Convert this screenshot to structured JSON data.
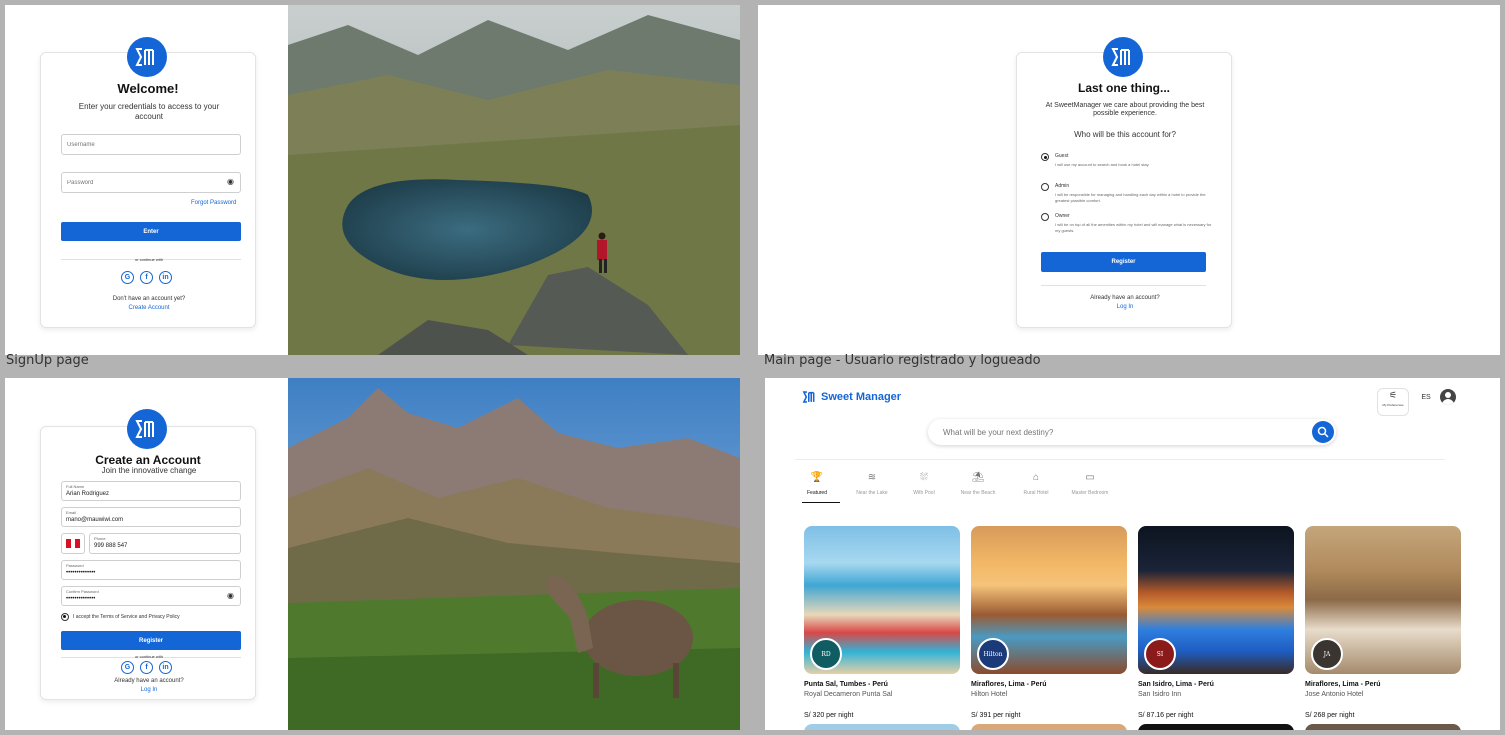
{
  "frames": {
    "signup_label": "SignUp page",
    "main_label": "Main page - Usuario registrado y logueado"
  },
  "login": {
    "title": "Welcome!",
    "subtitle": "Enter your credentials to access to your account",
    "username_placeholder": "Username",
    "password_placeholder": "Password",
    "forgot": "Forgot Password",
    "enter_button": "Enter",
    "continue_with": "or continue with",
    "no_account": "Don't have an account yet?",
    "create_account": "Create Account"
  },
  "role": {
    "title": "Last one thing...",
    "subtitle": "At SweetManager we care about providing the best possible experience.",
    "question": "Who will be this account for?",
    "options": [
      {
        "title": "Guest",
        "desc": "I will use my account to search and book a hotel stay.",
        "checked": true
      },
      {
        "title": "Admin",
        "desc": "I will be responsible for managing and handling each day within a hotel to provide the greatest possible comfort.",
        "checked": false
      },
      {
        "title": "Owner",
        "desc": "I will be on top of all the amenities within my hotel and will manage what is necessary for my guests.",
        "checked": false
      }
    ],
    "register_button": "Register",
    "already": "Already have an account?",
    "login_link": "Log In"
  },
  "signup": {
    "title": "Create an Account",
    "subtitle": "Join the innovative change",
    "fullname_label": "Full Name",
    "fullname_value": "Arian Rodriguez",
    "email_label": "Email",
    "email_value": "mano@mauwiwi.com",
    "phone_label": "Phone",
    "phone_value": "999 888 547",
    "password_label": "Password",
    "password_value": "••••••••••••••",
    "confirm_label": "Confirm Password",
    "confirm_value": "••••••••••••••",
    "terms": "I accept the Terms of Service and Privacy Policy",
    "register_button": "Register",
    "continue_with": "or continue with",
    "already": "Already have an account?",
    "login_link": "Log In"
  },
  "main": {
    "brand": "Sweet Manager",
    "preferences": "My Preferences",
    "lang": "ES",
    "search_placeholder": "What will be your next destiny?",
    "categories": [
      {
        "label": "Featured",
        "icon": "trophy-icon",
        "glyph": "🏆"
      },
      {
        "label": "Near the Lake",
        "icon": "lake-icon",
        "glyph": "≋"
      },
      {
        "label": "With Pool",
        "icon": "pool-icon",
        "glyph": "⛆"
      },
      {
        "label": "Near the Beach",
        "icon": "beach-icon",
        "glyph": "⛱"
      },
      {
        "label": "Rural Hotel",
        "icon": "rural-icon",
        "glyph": "⌂"
      },
      {
        "label": "Master Bedroom",
        "icon": "bed-icon",
        "glyph": "▭"
      }
    ],
    "hotels": [
      {
        "location": "Punta Sal, Tumbes - Perú",
        "name": "Royal Decameron Punta Sal",
        "price": "S/ 320 per night",
        "badge": "RD"
      },
      {
        "location": "Miraflores, Lima - Perú",
        "name": "Hilton Hotel",
        "price": "S/ 391 per night",
        "badge": "Hilton"
      },
      {
        "location": "San Isidro, Lima - Perú",
        "name": "San Isidro Inn",
        "price": "S/ 87.16 per night",
        "badge": "SI"
      },
      {
        "location": "Miraflores, Lima - Perú",
        "name": "Jose Antonio Hotel",
        "price": "S/ 268 per night",
        "badge": "JA"
      }
    ]
  },
  "colors": {
    "brand_blue": "#1466d6",
    "background": "#b3b3b3"
  }
}
